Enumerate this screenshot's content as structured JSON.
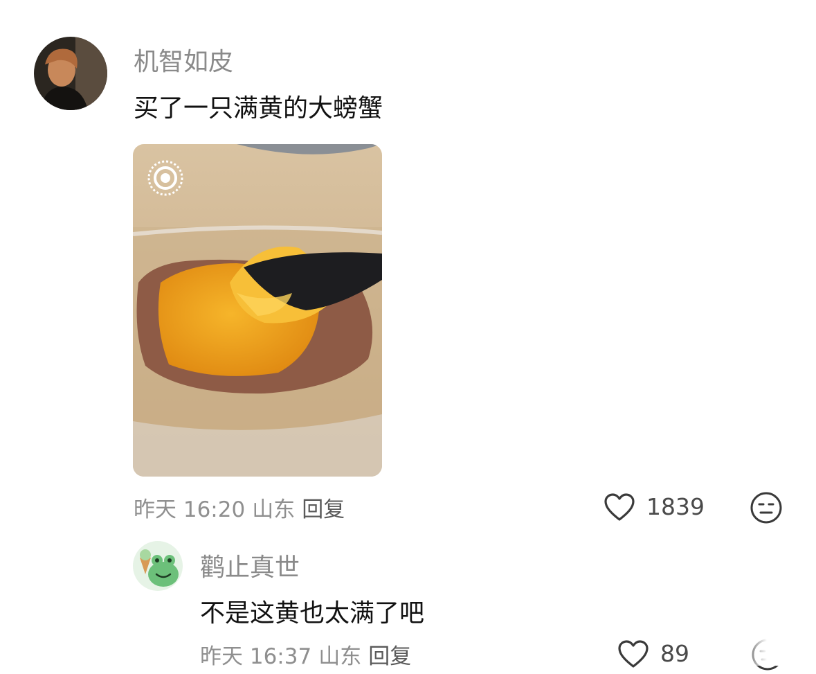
{
  "comments": [
    {
      "username": "机智如皮",
      "text": "买了一只满黄的大螃蟹",
      "time": "昨天 16:20",
      "location": "山东",
      "reply_label": "回复",
      "likes": "1839",
      "icons": [
        "heart-icon",
        "neutral-face-icon"
      ]
    },
    {
      "username": "鹳止真世",
      "text": "不是这黄也太满了吧",
      "time": "昨天 16:37",
      "location": "山东",
      "reply_label": "回复",
      "likes": "89",
      "icons": [
        "heart-icon",
        "neutral-face-icon"
      ]
    }
  ],
  "colors": {
    "username": "#8a8a8a",
    "text": "#111111",
    "meta": "#8f8f8f",
    "icon": "#3a3a3a"
  }
}
